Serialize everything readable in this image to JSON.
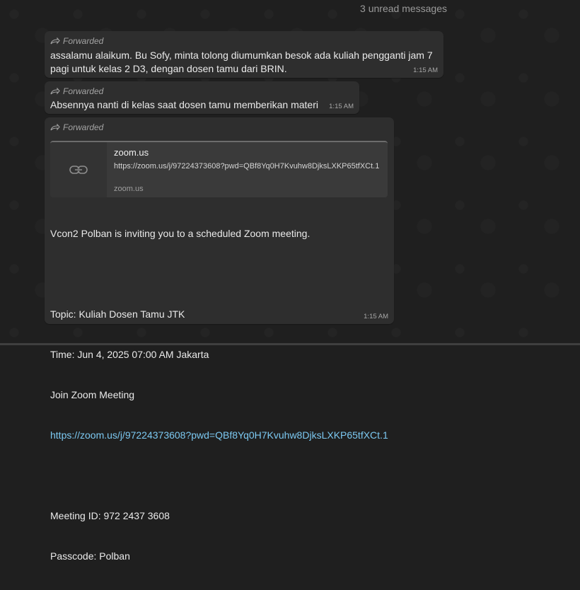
{
  "chat": {
    "unread_label": "3 unread messages"
  },
  "messages": [
    {
      "forwarded_label": "Forwarded",
      "text": "assalamu alaikum. Bu Sofy, minta tolong diumumkan besok ada kuliah pengganti jam 7 pagi untuk kelas 2 D3, dengan dosen tamu dari BRIN.",
      "time": "1:15 AM"
    },
    {
      "forwarded_label": "Forwarded",
      "text": "Absennya nanti di kelas saat dosen tamu memberikan materi",
      "time": "1:15 AM"
    },
    {
      "forwarded_label": "Forwarded",
      "link_preview": {
        "title": "zoom.us",
        "url": "https://zoom.us/j/97224373608?pwd=QBf8Yq0H7Kvuhw8DjksLXKP65tfXCt.1",
        "domain": "zoom.us"
      },
      "body_intro": "Vcon2 Polban is inviting you to a scheduled Zoom meeting.",
      "topic": "Topic: Kuliah Dosen Tamu JTK",
      "time_line": "Time: Jun 4, 2025 07:00 AM Jakarta",
      "join_label": "Join Zoom Meeting",
      "join_url": "https://zoom.us/j/97224373608?pwd=QBf8Yq0H7Kvuhw8DjksLXKP65tfXCt.1",
      "meeting_id": "Meeting ID: 972 2437 3608",
      "passcode": "Passcode: Polban",
      "time": "1:15 AM"
    }
  ],
  "icons": {
    "forward": "forward-arrow-icon",
    "link": "link-icon"
  },
  "colors": {
    "background": "#1f1f1f",
    "bubble": "#2e2e2e",
    "link": "#7cc9f2"
  }
}
